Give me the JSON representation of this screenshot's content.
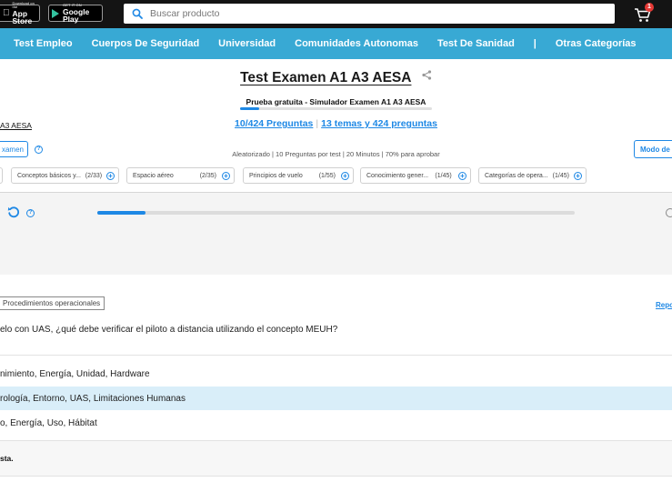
{
  "topbar": {
    "appstore": {
      "small": "Download on the",
      "big": "App Store"
    },
    "googleplay": {
      "small": "GET IT ON",
      "big": "Google Play"
    },
    "search_placeholder": "Buscar producto",
    "cart_count": "1"
  },
  "nav": {
    "items": [
      "Test Empleo",
      "Cuerpos De Seguridad",
      "Universidad",
      "Comunidades Autonomas",
      "Test De Sanidad"
    ],
    "separator": "|",
    "other": "Otras Categorías"
  },
  "header": {
    "title": "Test Examen A1 A3 AESA",
    "subtitle": "Prueba gratuita - Simulador Examen A1 A3 AESA",
    "progress_fraction": 0.1,
    "breadcrumb_fragment": "A3 AESA",
    "questions_link": "10/424 Preguntas",
    "links_separator": "|",
    "topics_link": "13 temas y 424 preguntas",
    "mode_left_label": "xamen",
    "config": "Aleatorizado | 10 Preguntas por test | 20 Minutos | 70% para aprobar",
    "mode_right_label": "Modo de",
    "help_symbol": "?"
  },
  "topics": [
    {
      "label": "Conceptos básicos y...",
      "count": "(2/33)"
    },
    {
      "label": "Espacio aéreo",
      "count": "(2/35)"
    },
    {
      "label": "Principios de vuelo",
      "count": "(1/55)"
    },
    {
      "label": "Conocimiento gener...",
      "count": "(1/45)"
    },
    {
      "label": "Categorías de opera...",
      "count": "(1/45)"
    }
  ],
  "test_progress": {
    "fraction": 0.1
  },
  "question": {
    "tag": "Procedimientos operacionales",
    "report": "Repo",
    "text": "elo con UAS, ¿qué debe verificar el piloto a distancia utilizando el concepto MEUH?",
    "options": [
      {
        "text": "nimiento, Energía, Unidad, Hardware",
        "selected": false
      },
      {
        "text": "rología, Entorno, UAS, Limitaciones Humanas",
        "selected": true
      },
      {
        "text": "o, Energía, Uso, Hábitat",
        "selected": false
      }
    ],
    "answer_label": "sta."
  },
  "colors": {
    "topbar": "#141414",
    "nav": "#38a9d4",
    "accent": "#1e88e5",
    "selected_option": "#d9eef9",
    "cart_badge": "#e53935"
  }
}
